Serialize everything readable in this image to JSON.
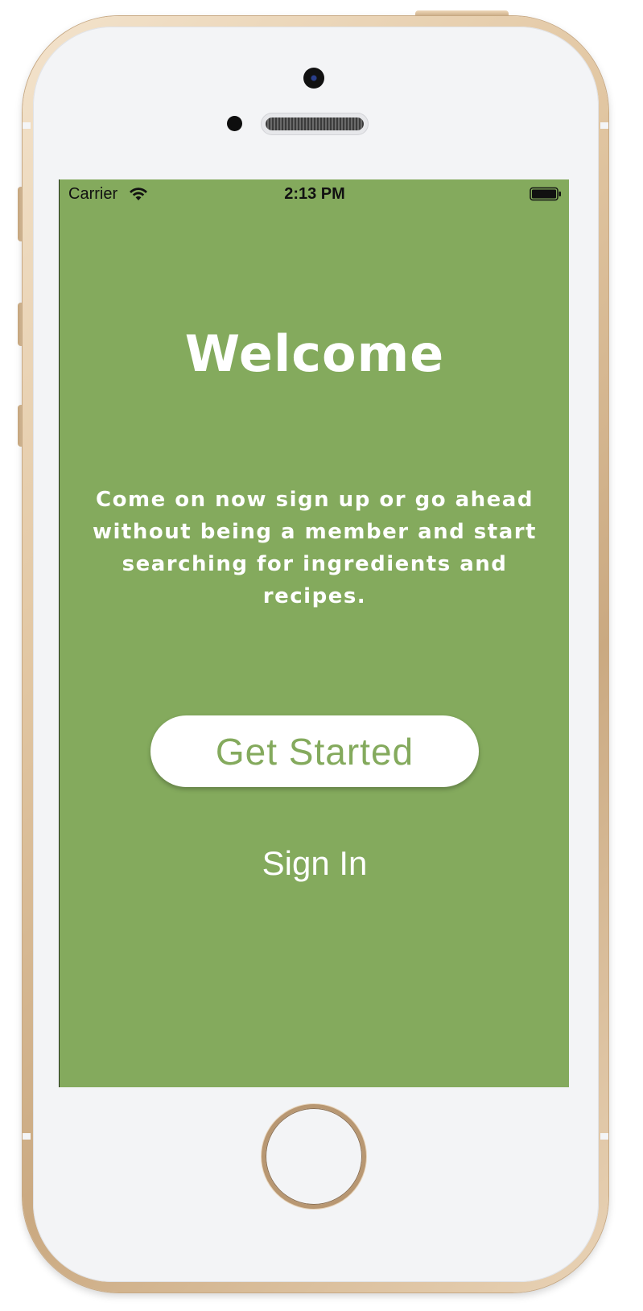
{
  "status_bar": {
    "carrier": "Carrier",
    "time": "2:13 PM"
  },
  "welcome": {
    "title": "Welcome",
    "intro_lines": [
      "Come on now sign up or go ahead",
      "without being a member and start",
      "searching for ingredients and recipes."
    ]
  },
  "actions": {
    "get_started_label": "Get Started",
    "sign_in_label": "Sign In"
  },
  "colors": {
    "screen_background": "#84aa5d",
    "button_background": "#ffffff",
    "button_text": "#84aa5d",
    "text": "#ffffff"
  },
  "icons": {
    "wifi": "wifi-icon",
    "battery": "battery-icon",
    "home": "home-button-icon"
  }
}
